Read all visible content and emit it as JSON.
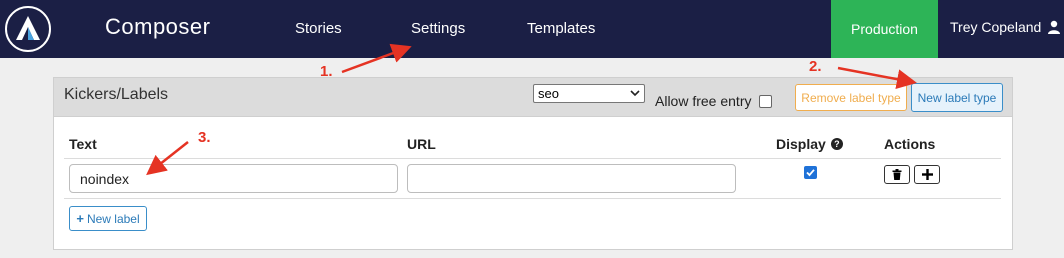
{
  "navbar": {
    "brand": "Composer",
    "links": [
      {
        "label": "Stories"
      },
      {
        "label": "Settings"
      },
      {
        "label": "Templates"
      }
    ],
    "environment": "Production",
    "user": "Trey Copeland"
  },
  "annotations": [
    "1.",
    "2.",
    "3."
  ],
  "colors": {
    "navbar_bg": "#1b1f45",
    "environment_bg": "#2db457",
    "annotation": "#e53323",
    "primary": "#3a8ec9",
    "warning": "#f0ad4e"
  },
  "panel": {
    "title": "Kickers/Labels",
    "type_select_value": "seo",
    "free_entry_label": "Allow free entry",
    "free_entry_checked": false,
    "remove_type_label": "Remove label type",
    "new_type_label": "New label type",
    "columns": {
      "text": "Text",
      "url": "URL",
      "display": "Display",
      "actions": "Actions"
    },
    "rows": [
      {
        "text": "noindex",
        "url": "",
        "display": true
      }
    ],
    "new_label_button": "New label"
  }
}
